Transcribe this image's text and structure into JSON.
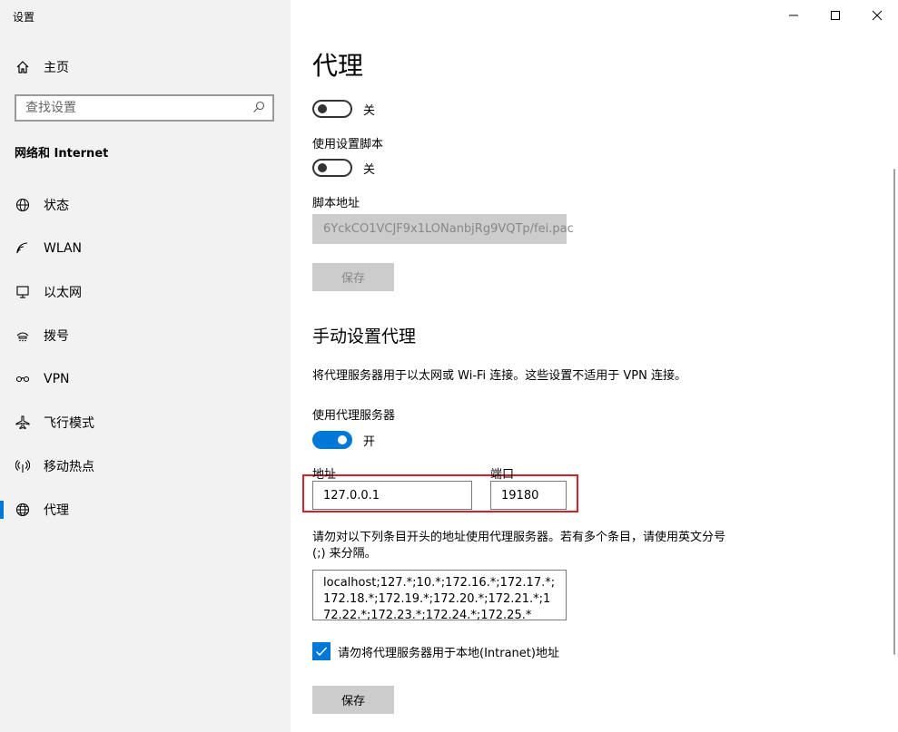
{
  "window": {
    "title": "设置"
  },
  "sidebar": {
    "home_label": "主页",
    "search_placeholder": "查找设置",
    "section_title": "网络和 Internet",
    "items": [
      {
        "label": "状态",
        "icon": "globe-status-icon"
      },
      {
        "label": "WLAN",
        "icon": "wifi-icon"
      },
      {
        "label": "以太网",
        "icon": "ethernet-icon"
      },
      {
        "label": "拨号",
        "icon": "dialup-icon"
      },
      {
        "label": "VPN",
        "icon": "vpn-icon"
      },
      {
        "label": "飞行模式",
        "icon": "airplane-icon"
      },
      {
        "label": "移动热点",
        "icon": "hotspot-icon"
      },
      {
        "label": "代理",
        "icon": "globe-icon",
        "active": true
      }
    ]
  },
  "main": {
    "title": "代理",
    "auto": {
      "detect_toggle_state": "关",
      "use_script_label": "使用设置脚本",
      "use_script_state": "关",
      "script_address_label": "脚本地址",
      "script_address_value": "6YckCO1VCJF9x1LONanbjRg9VQTp/fei.pac",
      "save_label": "保存"
    },
    "manual": {
      "heading": "手动设置代理",
      "description": "将代理服务器用于以太网或 Wi-Fi 连接。这些设置不适用于 VPN 连接。",
      "use_proxy_label": "使用代理服务器",
      "use_proxy_state": "开",
      "address_label": "地址",
      "address_value": "127.0.0.1",
      "port_label": "端口",
      "port_value": "19180",
      "exceptions_description": "请勿对以下列条目开头的地址使用代理服务器。若有多个条目，请使用英文分号 (;) 来分隔。",
      "exceptions_value": "localhost;127.*;10.*;172.16.*;172.17.*;172.18.*;172.19.*;172.20.*;172.21.*;172.22.*;172.23.*;172.24.*;172.25.*",
      "bypass_local_label": "请勿将代理服务器用于本地(Intranet)地址",
      "bypass_local_checked": true,
      "save_label": "保存"
    }
  },
  "colors": {
    "accent": "#0078d7",
    "highlight": "#d81e28",
    "sidebar_bg": "#f2f2f2"
  }
}
